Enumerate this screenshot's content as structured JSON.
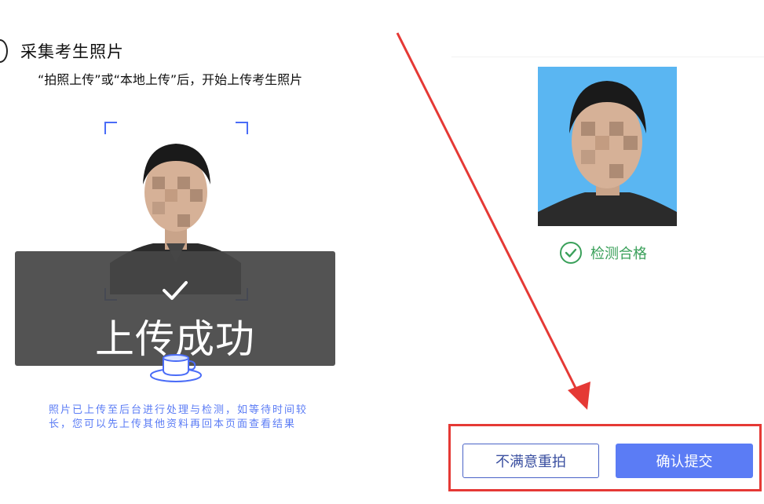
{
  "header": {
    "title": "采集考生照片",
    "subtitle": "“拍照上传”或“本地上传”后，开始上传考生照片"
  },
  "upload_overlay": {
    "success_text": "上传成功"
  },
  "notice": {
    "text": "照片已上传至后台进行处理与检测，如等待时间较长，您可以先上传其他资料再回本页面查看结果"
  },
  "result": {
    "status_text": "检测合格",
    "status_color": "#3aa05a"
  },
  "actions": {
    "retake_label": "不满意重拍",
    "submit_label": "确认提交"
  },
  "colors": {
    "accent": "#5b7cf5",
    "annotation": "#e53935",
    "photo_background": "#5ab6f2"
  },
  "icons": {
    "overlay": "checkmark-icon",
    "status": "check-circle-icon",
    "upload": "coffee-cup-icon"
  }
}
